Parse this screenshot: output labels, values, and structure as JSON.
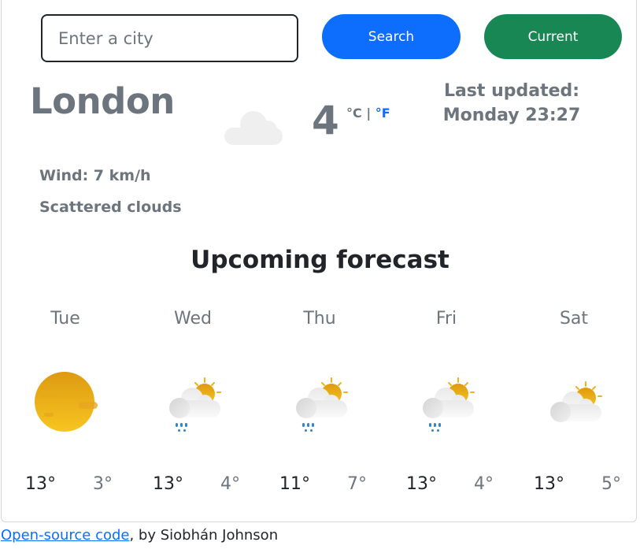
{
  "search": {
    "placeholder": "Enter a city",
    "value": "",
    "search_label": "Search",
    "current_label": "Current"
  },
  "current": {
    "city": "London",
    "temperature": "4",
    "unit_celsius": "°C",
    "unit_separator": "|",
    "unit_fahrenheit": "°F",
    "icon": "cloud-icon",
    "last_updated_label": "Last updated:",
    "last_updated_value": "Monday 23:27",
    "wind": "Wind: 7 km/h",
    "description": "Scattered clouds"
  },
  "forecast": {
    "title": "Upcoming forecast",
    "days": [
      {
        "day": "Tue",
        "icon": "sun-icon",
        "max": "13°",
        "min": "3°"
      },
      {
        "day": "Wed",
        "icon": "sun-cloud-rain-icon",
        "max": "13°",
        "min": "4°"
      },
      {
        "day": "Thu",
        "icon": "sun-cloud-rain-icon",
        "max": "11°",
        "min": "7°"
      },
      {
        "day": "Fri",
        "icon": "sun-cloud-rain-icon",
        "max": "13°",
        "min": "4°"
      },
      {
        "day": "Sat",
        "icon": "sun-cloud-icon",
        "max": "13°",
        "min": "5°"
      }
    ]
  },
  "footer": {
    "link_text": "Open-source code",
    "suffix": ", by Siobhán Johnson"
  },
  "colors": {
    "primary": "#0d6efd",
    "success": "#198754",
    "muted": "#6c757d",
    "dark": "#212529"
  }
}
